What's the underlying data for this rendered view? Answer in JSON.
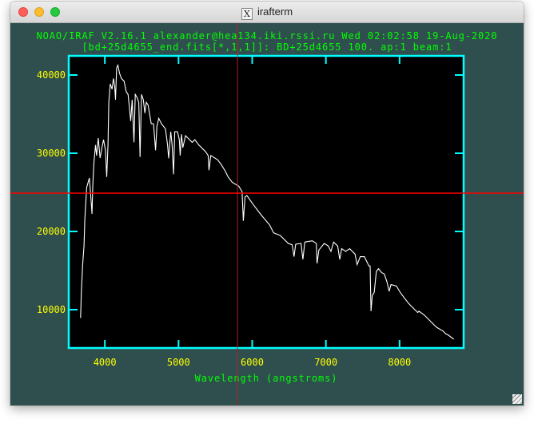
{
  "window": {
    "title": "irafterm",
    "title_icon": "x11-icon"
  },
  "header": {
    "line1": "NOAO/IRAF V2.16.1 alexander@hea134.iki.rssi.ru Wed 02:02:58 19-Aug-2020",
    "line2": "[bd+25d4655_end.fits[*,1,1]]: BD+25d4655 100. ap:1 beam:1"
  },
  "colors": {
    "background": "#2f4f4f",
    "header_text": "#00ff00",
    "frame": "#00ffff",
    "tick_labels": "#ffff00",
    "spectrum": "#ffffff",
    "cursor_horizontal": "#ff0000",
    "cursor_vertical": "#b02020"
  },
  "chart_data": {
    "type": "line",
    "title": "",
    "xlabel": "Wavelength (angstroms)",
    "ylabel": "",
    "xlim": [
      3510,
      8870
    ],
    "ylim": [
      5100,
      42450
    ],
    "xticks": [
      4000,
      5000,
      6000,
      7000,
      8000
    ],
    "yticks": [
      10000,
      20000,
      30000,
      40000
    ],
    "grid": false,
    "cursor": {
      "x": 5800,
      "y": 24900
    },
    "series": [
      {
        "x": [
          3671,
          3681,
          3699,
          3717,
          3728,
          3753,
          3790,
          3808,
          3826,
          3837,
          3851,
          3873,
          3888,
          3910,
          3935,
          3960,
          3982,
          4008,
          4025,
          4043,
          4054,
          4073,
          4098,
          4116,
          4134,
          4145,
          4160,
          4177,
          4199,
          4225,
          4261,
          4290,
          4315,
          4334,
          4351,
          4370,
          4395,
          4413,
          4435,
          4460,
          4478,
          4497,
          4522,
          4543,
          4562,
          4587,
          4605,
          4630,
          4660,
          4677,
          4688,
          4707,
          4732,
          4768,
          4823,
          4851,
          4866,
          4895,
          4913,
          4932,
          4949,
          4986,
          5011,
          5022,
          5040,
          5058,
          5095,
          5149,
          5185,
          5221,
          5275,
          5366,
          5402,
          5413,
          5438,
          5529,
          5584,
          5638,
          5674,
          5728,
          5818,
          5862,
          5880,
          5902,
          5927,
          6018,
          6127,
          6236,
          6290,
          6380,
          6489,
          6543,
          6568,
          6590,
          6663,
          6688,
          6714,
          6815,
          6870,
          6880,
          6905,
          6978,
          7033,
          7069,
          7105,
          7160,
          7188,
          7214,
          7268,
          7323,
          7395,
          7424,
          7467,
          7522,
          7558,
          7584,
          7601,
          7612,
          7630,
          7656,
          7685,
          7714,
          7758,
          7793,
          7829,
          7859,
          7884,
          7957,
          8011,
          8065,
          8120,
          8192,
          8247,
          8264,
          8337,
          8427,
          8500,
          8590,
          8627,
          8663,
          8736
        ],
        "y": [
          8950,
          12350,
          15750,
          18160,
          21530,
          25610,
          26840,
          24590,
          22240,
          25920,
          28670,
          31050,
          29700,
          31940,
          29390,
          30710,
          31730,
          30410,
          26970,
          31050,
          36500,
          38880,
          38190,
          39560,
          38540,
          36840,
          40920,
          41260,
          40240,
          39560,
          39220,
          37860,
          37520,
          35820,
          34110,
          36840,
          31390,
          37520,
          37170,
          36500,
          29520,
          37520,
          36840,
          35130,
          36500,
          36160,
          35130,
          33780,
          33780,
          31730,
          30380,
          33440,
          34460,
          33780,
          33100,
          31050,
          29360,
          32760,
          31050,
          27320,
          32760,
          32760,
          31730,
          29700,
          32420,
          30710,
          32250,
          31730,
          31390,
          31730,
          31050,
          30200,
          29700,
          27830,
          29700,
          29180,
          28500,
          27650,
          26970,
          26300,
          25790,
          25100,
          21360,
          24420,
          24590,
          23400,
          22040,
          20850,
          19830,
          19490,
          18470,
          18300,
          16770,
          18370,
          18470,
          16430,
          18640,
          18810,
          18470,
          15920,
          17620,
          18470,
          18130,
          17450,
          18640,
          18130,
          16430,
          17790,
          17450,
          17790,
          17110,
          15750,
          16770,
          16770,
          16090,
          15580,
          15580,
          9800,
          11840,
          12180,
          14900,
          15240,
          14730,
          14560,
          13540,
          12350,
          13200,
          13030,
          12180,
          11500,
          10820,
          10140,
          9630,
          9800,
          9290,
          8440,
          7760,
          7260,
          6910,
          6740,
          6220
        ]
      }
    ]
  }
}
